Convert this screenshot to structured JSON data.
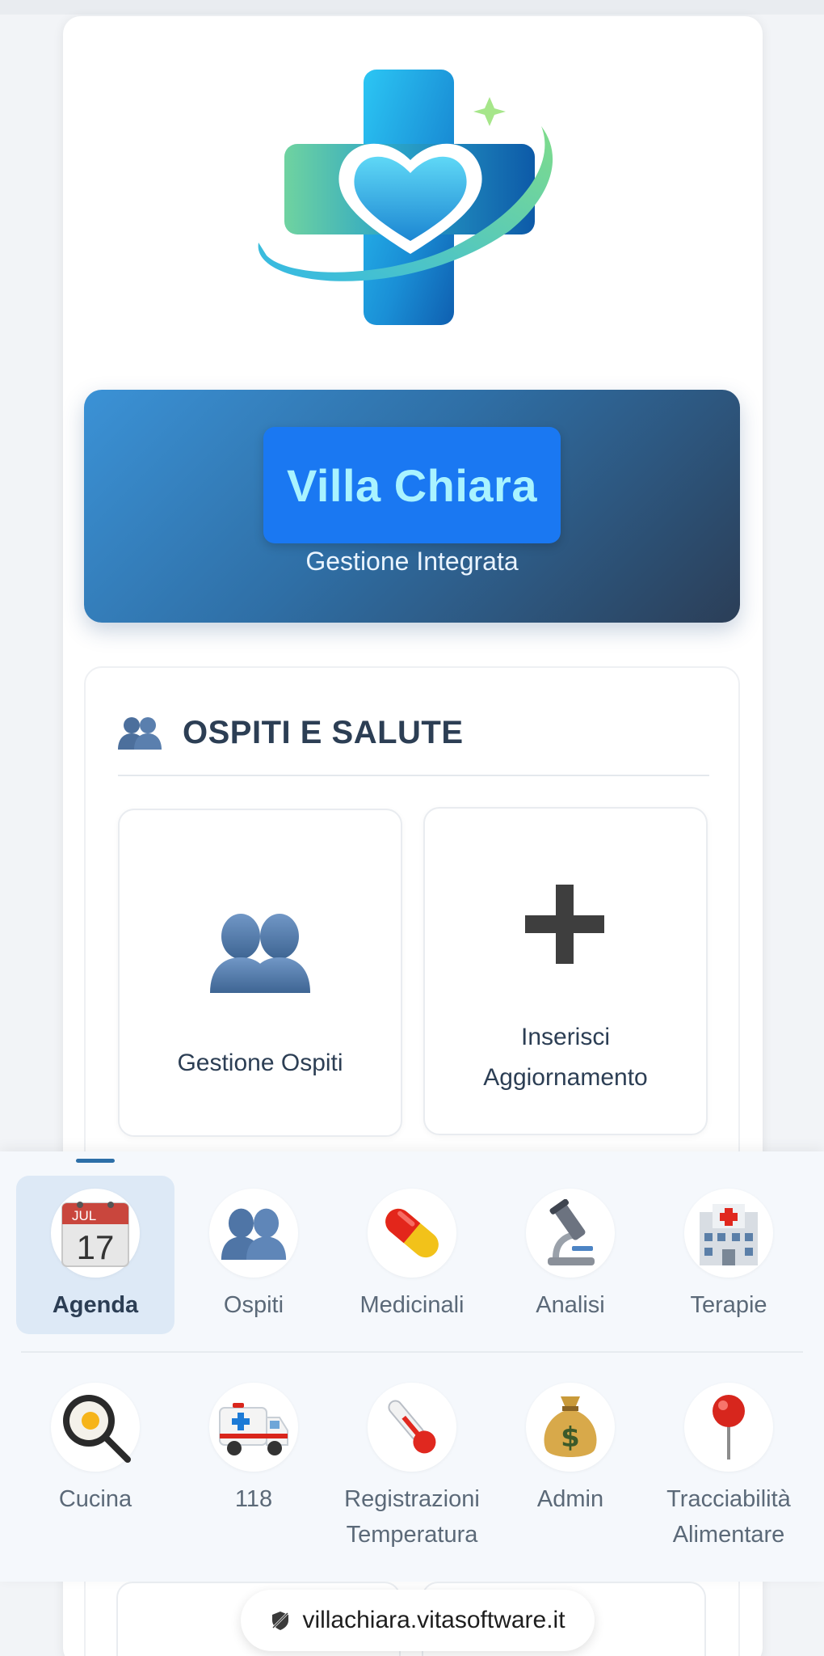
{
  "brand": {
    "name": "Villa Chiara",
    "subtitle": "Gestione Integrata",
    "logo_icon": "medical-cross-heart-logo-icon"
  },
  "section": {
    "title": "OSPITI E SALUTE",
    "icon": "people-icon",
    "tiles": [
      {
        "label": "Gestione Ospiti",
        "icon": "people-icon"
      },
      {
        "label": "Inserisci Aggiornamento",
        "icon": "plus-icon"
      }
    ]
  },
  "bottom_nav": {
    "row1": [
      {
        "label": "Agenda",
        "icon": "calendar-icon",
        "calendar_month": "JUL",
        "calendar_day": "17",
        "active": true
      },
      {
        "label": "Ospiti",
        "icon": "people-icon"
      },
      {
        "label": "Medicinali",
        "icon": "pill-icon"
      },
      {
        "label": "Analisi",
        "icon": "microscope-icon"
      },
      {
        "label": "Terapie",
        "icon": "hospital-icon"
      }
    ],
    "row2": [
      {
        "label": "Cucina",
        "icon": "frying-pan-icon"
      },
      {
        "label": "118",
        "icon": "ambulance-icon"
      },
      {
        "label": "Registrazioni Temperatura",
        "icon": "thermometer-icon"
      },
      {
        "label": "Admin",
        "icon": "money-bag-icon"
      },
      {
        "label": "Tracciabilità Alimentare",
        "icon": "pushpin-icon"
      }
    ]
  },
  "browser": {
    "url": "villachiara.vitasoftware.it"
  },
  "colors": {
    "hero_start": "#3b92d6",
    "hero_end": "#2b3e57",
    "title_box": "#1a78f2",
    "title_text": "#a9f3ff",
    "active_nav": "#dde9f6"
  }
}
